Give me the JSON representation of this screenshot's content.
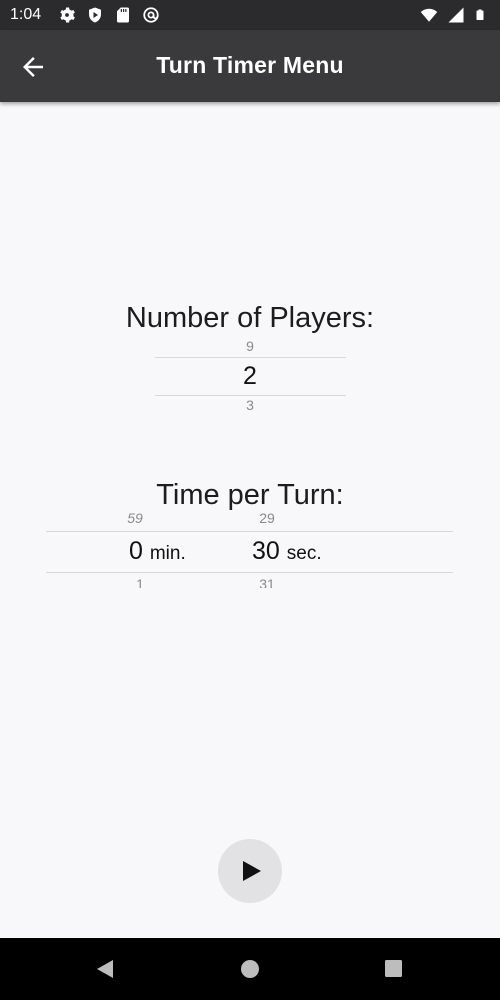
{
  "status_bar": {
    "time": "1:04",
    "left_icons": [
      "settings-icon",
      "shield-icon",
      "sd-card-icon",
      "at-sign-icon"
    ],
    "right_icons": [
      "wifi-icon",
      "signal-icon",
      "battery-icon"
    ]
  },
  "app_bar": {
    "title": "Turn Timer Menu",
    "back_icon": "arrow-left-icon"
  },
  "players_picker": {
    "label": "Number of Players:",
    "previous": "9",
    "selected": "2",
    "next": "3"
  },
  "time_picker": {
    "label": "Time per Turn:",
    "minutes": {
      "previous": "59",
      "selected": "0",
      "next": "1",
      "unit": "min."
    },
    "seconds": {
      "previous": "29",
      "selected": "30",
      "next": "31",
      "unit": "sec."
    }
  },
  "play_button": {
    "icon": "play-icon"
  },
  "nav_bar": {
    "icons": [
      "back-triangle-icon",
      "home-circle-icon",
      "recents-square-icon"
    ]
  },
  "colors": {
    "status_bar_bg": "#2b2a2c",
    "app_bar_bg": "#3a393b",
    "background": "#f8f7f9",
    "play_button_bg": "#e2e1e3"
  }
}
